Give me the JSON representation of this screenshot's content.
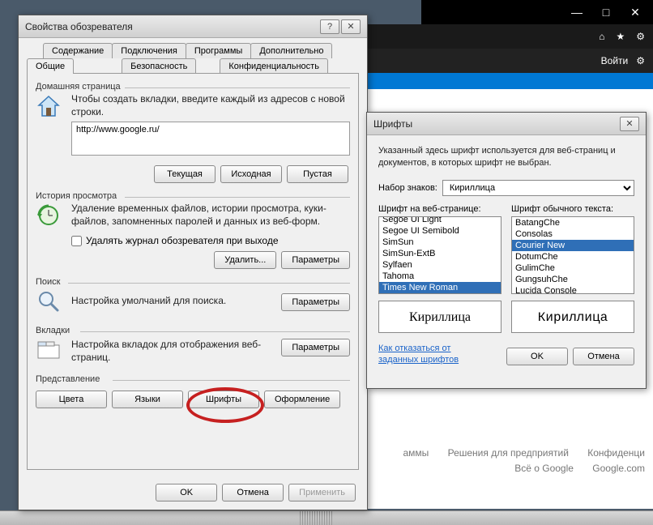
{
  "browser": {
    "login_text": "Войти",
    "footer": {
      "l1a": "аммы",
      "l1b": "Решения для предприятий",
      "l1c": "Конфиденци",
      "l2a": "Всё о Google",
      "l2b": "Google.com"
    }
  },
  "io": {
    "title": "Свойства обозревателя",
    "help": "?",
    "close": "✕",
    "tabs": {
      "content": "Содержание",
      "connections": "Подключения",
      "programs": "Программы",
      "advanced": "Дополнительно",
      "general": "Общие",
      "security": "Безопасность",
      "privacy": "Конфиденциальность"
    },
    "home": {
      "label": "Домашняя страница",
      "desc": "Чтобы создать вкладки, введите каждый из адресов с новой строки.",
      "url": "http://www.google.ru/",
      "btn_current": "Текущая",
      "btn_default": "Исходная",
      "btn_blank": "Пустая"
    },
    "history": {
      "label": "История просмотра",
      "desc": "Удаление временных файлов, истории просмотра, куки-файлов, запомненных паролей и данных из веб-форм.",
      "checkbox": "Удалять журнал обозревателя при выходе",
      "btn_delete": "Удалить...",
      "btn_params": "Параметры"
    },
    "search": {
      "label": "Поиск",
      "desc": "Настройка умолчаний для поиска.",
      "btn_params": "Параметры"
    },
    "tabs_section": {
      "label": "Вкладки",
      "desc": "Настройка вкладок для отображения веб-страниц.",
      "btn_params": "Параметры"
    },
    "appearance": {
      "label": "Представление",
      "btn_colors": "Цвета",
      "btn_langs": "Языки",
      "btn_fonts": "Шрифты",
      "btn_access": "Оформление"
    },
    "btn_ok": "OK",
    "btn_cancel": "Отмена",
    "btn_apply": "Применить"
  },
  "fonts": {
    "title": "Шрифты",
    "close": "✕",
    "desc": "Указанный здесь шрифт используется для веб-страниц и документов, в которых шрифт не выбран.",
    "charset_label": "Набор знаков:",
    "charset_value": "Кириллица",
    "webfont_label": "Шрифт на веб-странице:",
    "plainfont_label": "Шрифт обычного текста:",
    "web_list": [
      "Segoe UI Light",
      "Segoe UI Semibold",
      "SimSun",
      "SimSun-ExtB",
      "Sylfaen",
      "Tahoma",
      "Times New Roman"
    ],
    "plain_list": [
      "BatangChe",
      "Consolas",
      "Courier New",
      "DotumChe",
      "GulimChe",
      "GungsuhChe",
      "Lucida Console"
    ],
    "web_selected": "Times New Roman",
    "plain_selected": "Courier New",
    "preview": "Кириллица",
    "link": "Как отказаться от заданных шрифтов",
    "btn_ok": "OK",
    "btn_cancel": "Отмена"
  }
}
